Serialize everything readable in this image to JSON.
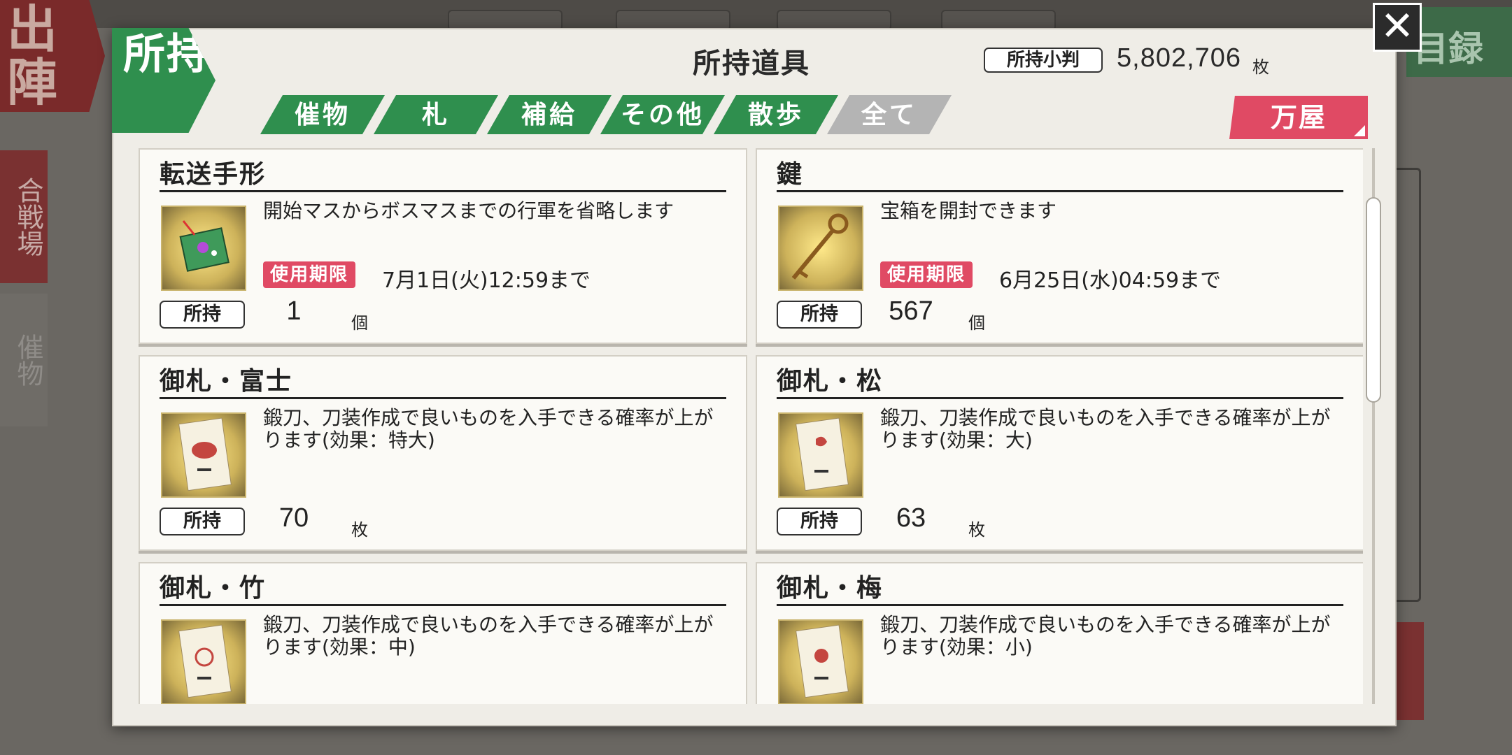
{
  "background": {
    "sortie_label": "出陣",
    "side_tab_1": "合戦場",
    "side_tab_2": "催物",
    "catalog_label": "目録"
  },
  "modal": {
    "badge": "所持",
    "title": "所持道具",
    "koban_label": "所持小判",
    "koban_value": "5,802,706",
    "koban_unit": "枚",
    "close_icon": "✕"
  },
  "tabs": [
    {
      "label": "催物",
      "active": true
    },
    {
      "label": "札",
      "active": true
    },
    {
      "label": "補給",
      "active": true
    },
    {
      "label": "その他",
      "active": true
    },
    {
      "label": "散歩",
      "active": true
    },
    {
      "label": "全て",
      "active": false
    }
  ],
  "shop_button": "万屋",
  "own_label": "所持",
  "expiry_label": "使用期限",
  "items": [
    {
      "name": "転送手形",
      "icon": "transfer-pass-icon",
      "description": "開始マスからボスマスまでの行軍を省略します",
      "expiry": "7月1日(火)12:59まで",
      "count": "1",
      "unit": "個"
    },
    {
      "name": "鍵",
      "icon": "key-icon",
      "description": "宝箱を開封できます",
      "expiry": "6月25日(水)04:59まで",
      "count": "567",
      "unit": "個"
    },
    {
      "name": "御札・富士",
      "icon": "fuji-charm-icon",
      "description": "鍛刀、刀装作成で良いものを入手できる確率が上がります(効果：特大)",
      "expiry": "",
      "count": "70",
      "unit": "枚"
    },
    {
      "name": "御札・松",
      "icon": "matsu-charm-icon",
      "description": "鍛刀、刀装作成で良いものを入手できる確率が上がります(効果：大)",
      "expiry": "",
      "count": "63",
      "unit": "枚"
    },
    {
      "name": "御札・竹",
      "icon": "take-charm-icon",
      "description": "鍛刀、刀装作成で良いものを入手できる確率が上がります(効果：中)",
      "expiry": "",
      "count": "",
      "unit": ""
    },
    {
      "name": "御札・梅",
      "icon": "ume-charm-icon",
      "description": "鍛刀、刀装作成で良いものを入手できる確率が上がります(効果：小)",
      "expiry": "",
      "count": "",
      "unit": ""
    }
  ],
  "scroll_position": 0.14,
  "scroll_visible_fraction": 0.37
}
